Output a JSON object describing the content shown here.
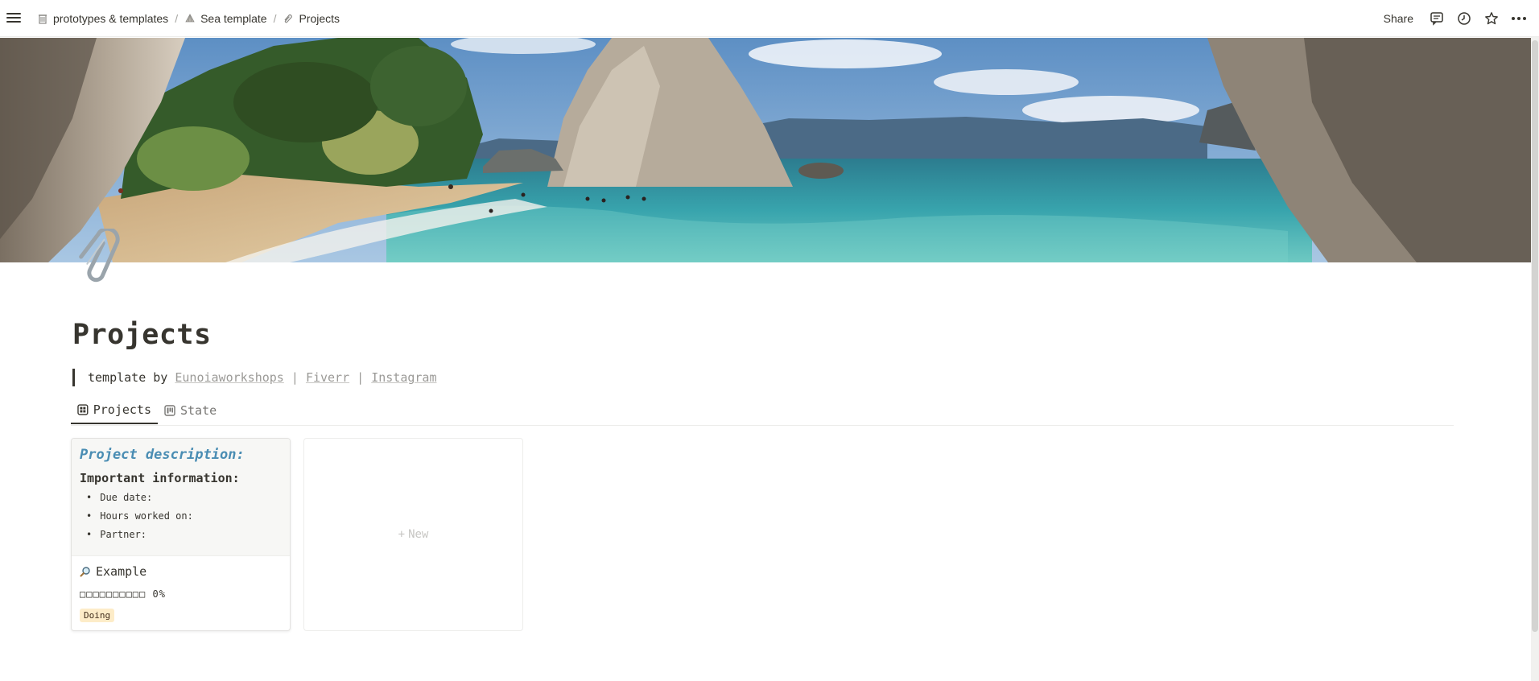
{
  "topbar": {
    "breadcrumbs": [
      {
        "label": "prototypes & templates",
        "icon": "trash-can-icon"
      },
      {
        "label": "Sea template",
        "icon": "shell-icon"
      },
      {
        "label": "Projects",
        "icon": "paperclip-icon"
      }
    ],
    "separator": "/",
    "share_label": "Share",
    "icons": [
      "comment-icon",
      "clock-icon",
      "star-icon",
      "more-icon"
    ]
  },
  "page": {
    "title": "Projects",
    "icon": "paperclip-icon",
    "quote": {
      "prefix": "template by ",
      "links": [
        "Eunoiaworkshops",
        "Fiverr",
        "Instagram"
      ],
      "separator": " | "
    }
  },
  "tabs": [
    {
      "label": "Projects",
      "icon": "gallery-icon",
      "active": true
    },
    {
      "label": "State",
      "icon": "board-icon",
      "active": false
    }
  ],
  "cards": [
    {
      "preview": {
        "heading": "Project description:",
        "subheading": "Important information:",
        "items": [
          "Due date:",
          "Hours worked on:",
          "Partner:"
        ]
      },
      "title": "Example",
      "title_icon": "magnifier-icon",
      "progress_text": "□□□□□□□□□□ 0%",
      "progress": 0,
      "status": "Doing"
    }
  ],
  "new_label": "New",
  "colors": {
    "accent_heading": "#4a8db3",
    "badge_bg": "#fdecc8",
    "text": "#37352f"
  }
}
